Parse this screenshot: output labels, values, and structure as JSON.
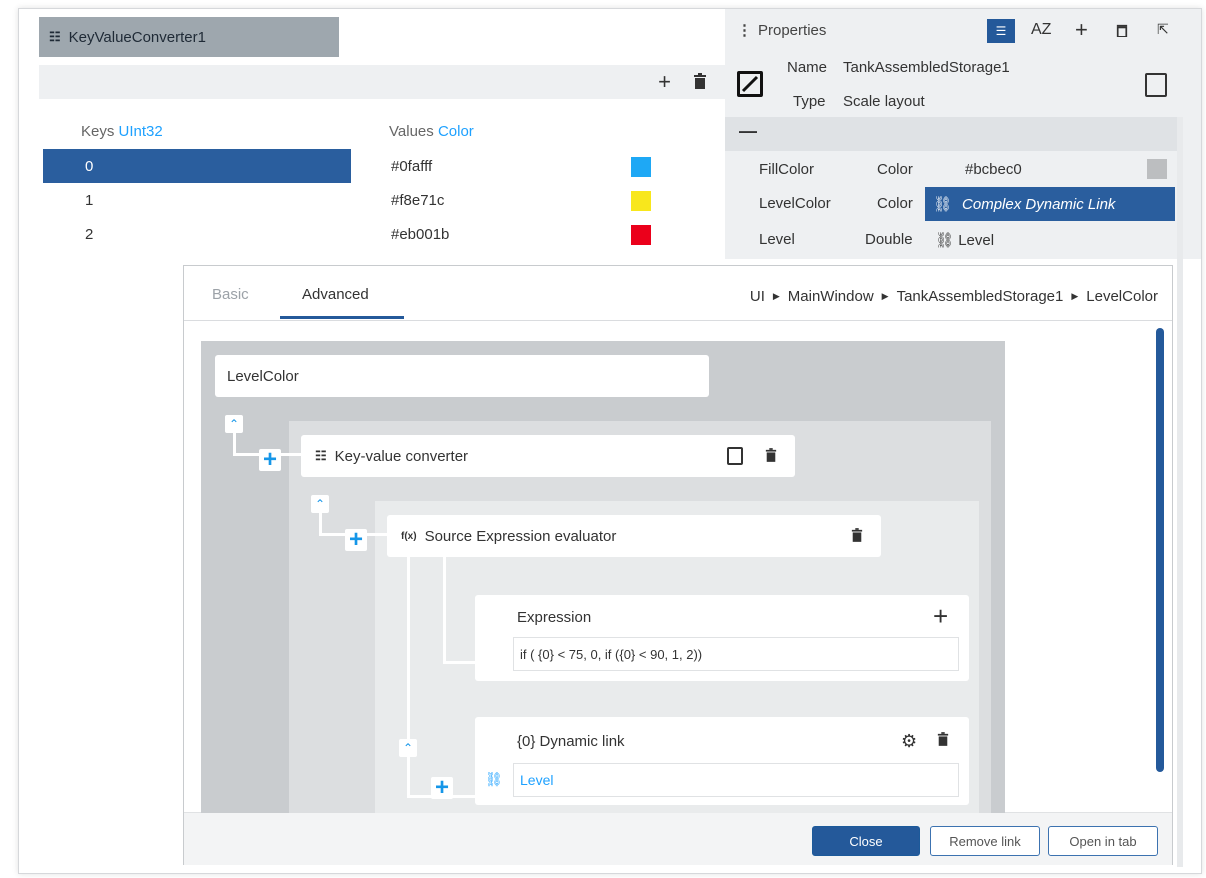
{
  "converter": {
    "tab_title": "KeyValueConverter1",
    "keys_label": "Keys",
    "keys_type": "UInt32",
    "values_label": "Values",
    "values_type": "Color",
    "rows": [
      {
        "key": "0",
        "value": "#0fafff",
        "color": "#1ea8f5"
      },
      {
        "key": "1",
        "value": "#f8e71c",
        "color": "#f8e71c"
      },
      {
        "key": "2",
        "value": "#eb001b",
        "color": "#eb001b"
      }
    ]
  },
  "properties": {
    "title": "Properties",
    "name_label": "Name",
    "name_value": "TankAssembledStorage1",
    "type_label": "Type",
    "type_value": "Scale layout",
    "sort_az": "AZ",
    "collapse": "—",
    "rows": [
      {
        "name": "FillColor",
        "type": "Color",
        "value": "#bcbec0"
      },
      {
        "name": "LevelColor",
        "type": "Color",
        "value": "Complex Dynamic Link"
      },
      {
        "name": "Level",
        "type": "Double",
        "value": "Level"
      }
    ]
  },
  "dialog": {
    "tabs": [
      "Basic",
      "Advanced"
    ],
    "breadcrumb": [
      "UI",
      "MainWindow",
      "TankAssembledStorage1",
      "LevelColor"
    ],
    "root_node": "LevelColor",
    "converter_node": "Key-value converter",
    "evaluator_node": "Source Expression evaluator",
    "evaluator_prefix": "f(x)",
    "expression_label": "Expression",
    "expression_value": "if ( {0} < 75, 0, if ({0} < 90, 1, 2))",
    "dynamic_link_label": "{0} Dynamic link",
    "dynamic_link_value": "Level",
    "buttons": {
      "close": "Close",
      "remove": "Remove link",
      "open": "Open in tab"
    }
  },
  "colors": {
    "accent": "#24599a",
    "link": "#1ea1ff",
    "selected_row": "#2a5e9e",
    "swatch_fill": "#bcbec0"
  }
}
